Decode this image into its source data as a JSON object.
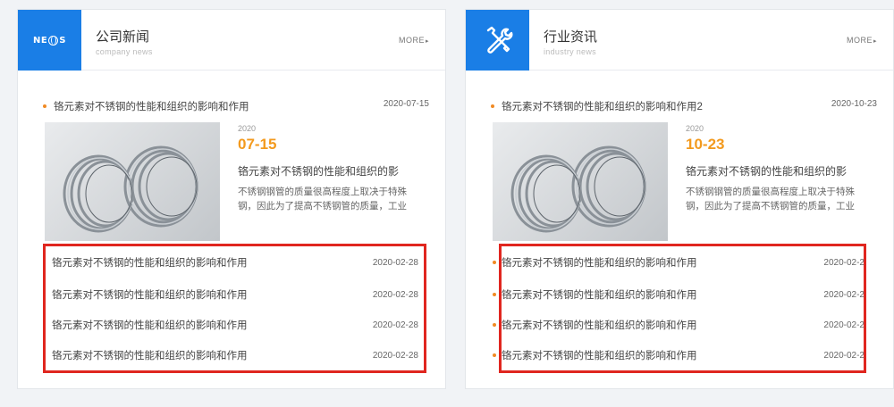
{
  "panels": [
    {
      "title": "公司新闻",
      "subtitle": "company news",
      "icon": "news-globe-icon",
      "icon_text": "NEWS",
      "more": "MORE",
      "top_item": {
        "title": "铬元素对不锈钢的性能和组织的影响和作用",
        "date": "2020-07-15"
      },
      "feature": {
        "year": "2020",
        "date": "07-15",
        "title": "铬元素对不锈钢的性能和组织的影",
        "desc": "不锈钢钢管的质量很高程度上取决于特殊钢，因此为了提高不锈钢管的质量，工业"
      },
      "list": [
        {
          "title": "铬元素对不锈钢的性能和组织的影响和作用",
          "date": "2020-02-28"
        },
        {
          "title": "铬元素对不锈钢的性能和组织的影响和作用",
          "date": "2020-02-28"
        },
        {
          "title": "铬元素对不锈钢的性能和组织的影响和作用",
          "date": "2020-02-28"
        },
        {
          "title": "铬元素对不锈钢的性能和组织的影响和作用",
          "date": "2020-02-28"
        }
      ]
    },
    {
      "title": "行业资讯",
      "subtitle": "industry news",
      "icon": "wrench-screwdriver-icon",
      "more": "MORE",
      "top_item": {
        "title": "铬元素对不锈钢的性能和组织的影响和作用2",
        "date": "2020-10-23"
      },
      "feature": {
        "year": "2020",
        "date": "10-23",
        "title": "铬元素对不锈钢的性能和组织的影",
        "desc": "不锈钢钢管的质量很高程度上取决于特殊钢，因此为了提高不锈钢管的质量，工业"
      },
      "list": [
        {
          "title": "铬元素对不锈钢的性能和组织的影响和作用",
          "date": "2020-02-2"
        },
        {
          "title": "铬元素对不锈钢的性能和组织的影响和作用",
          "date": "2020-02-2"
        },
        {
          "title": "铬元素对不锈钢的性能和组织的影响和作用",
          "date": "2020-02-2"
        },
        {
          "title": "铬元素对不锈钢的性能和组织的影响和作用",
          "date": "2020-02-2"
        }
      ]
    }
  ],
  "colors": {
    "accent_blue": "#1a7ee6",
    "date_orange": "#f39a1e",
    "bullet_orange": "#f08a24",
    "highlight_red": "#e0261f"
  }
}
